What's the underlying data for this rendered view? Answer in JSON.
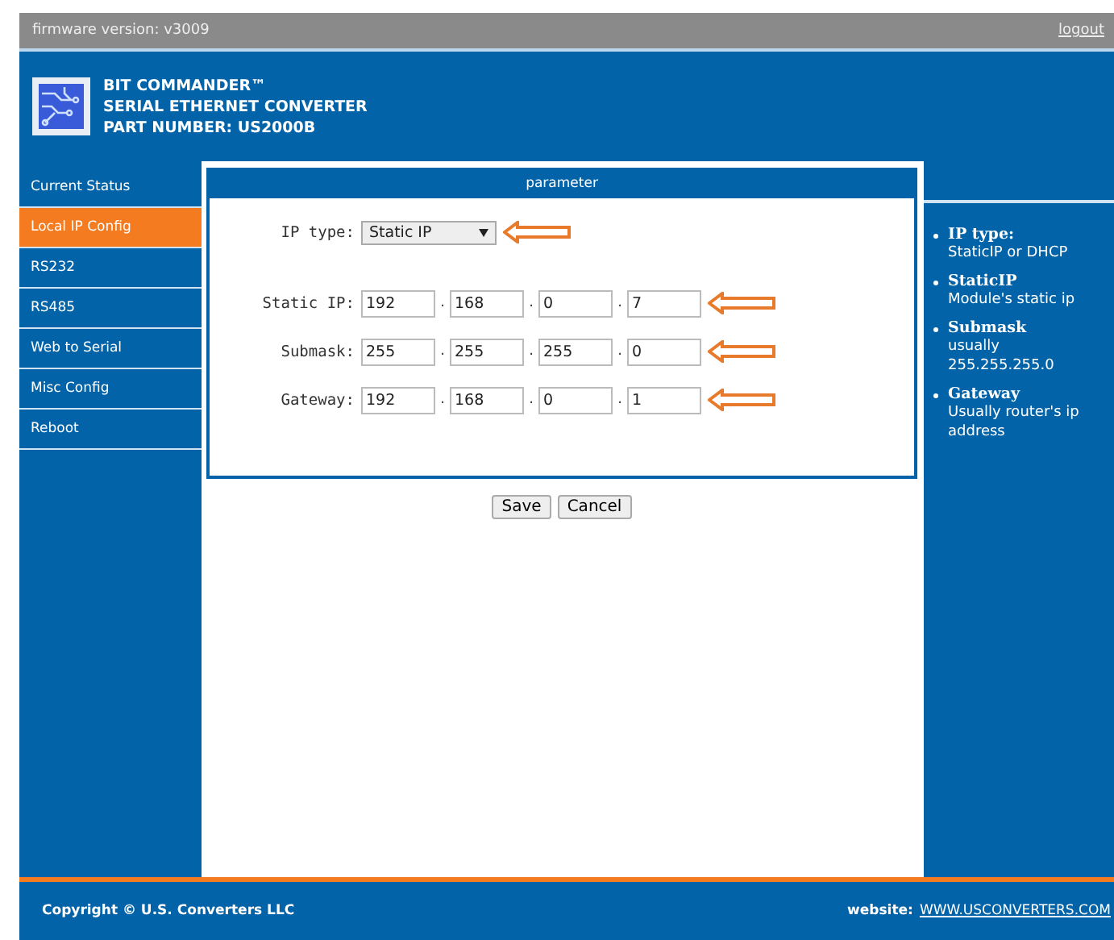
{
  "top_bar": {
    "firmware": "firmware version: v3009",
    "logout": "logout"
  },
  "header": {
    "lines": [
      "BIT COMMANDER™",
      "SERIAL ETHERNET CONVERTER",
      "PART NUMBER: US2000B"
    ]
  },
  "sidebar": {
    "items": [
      {
        "label": "Current Status",
        "selected": false
      },
      {
        "label": "Local IP Config",
        "selected": true
      },
      {
        "label": "RS232",
        "selected": false
      },
      {
        "label": "RS485",
        "selected": false
      },
      {
        "label": "Web to Serial",
        "selected": false
      },
      {
        "label": "Misc Config",
        "selected": false
      },
      {
        "label": "Reboot",
        "selected": false
      }
    ]
  },
  "panel": {
    "title": "parameter",
    "ip_type": {
      "label": "IP type:",
      "value": "Static IP",
      "arrow": true
    },
    "fields": [
      {
        "label": "Static IP:",
        "octets": [
          "192",
          "168",
          "0",
          "7"
        ],
        "arrow": true
      },
      {
        "label": "Submask:",
        "octets": [
          "255",
          "255",
          "255",
          "0"
        ],
        "arrow": true
      },
      {
        "label": "Gateway:",
        "octets": [
          "192",
          "168",
          "0",
          "1"
        ],
        "arrow": true
      }
    ],
    "separator": ".",
    "buttons": [
      "Save",
      "Cancel"
    ]
  },
  "help": {
    "items": [
      {
        "title": "IP type:",
        "text": "StaticIP or DHCP"
      },
      {
        "title": "StaticIP",
        "text": "Module's static ip"
      },
      {
        "title": "Submask",
        "text": "usually 255.255.255.0"
      },
      {
        "title": "Gateway",
        "text": "Usually router's ip address"
      }
    ]
  },
  "footer": {
    "copyright": "Copyright © U.S. Converters LLC",
    "website_label": "website:",
    "website": "WWW.USCONVERTERS.COM"
  }
}
